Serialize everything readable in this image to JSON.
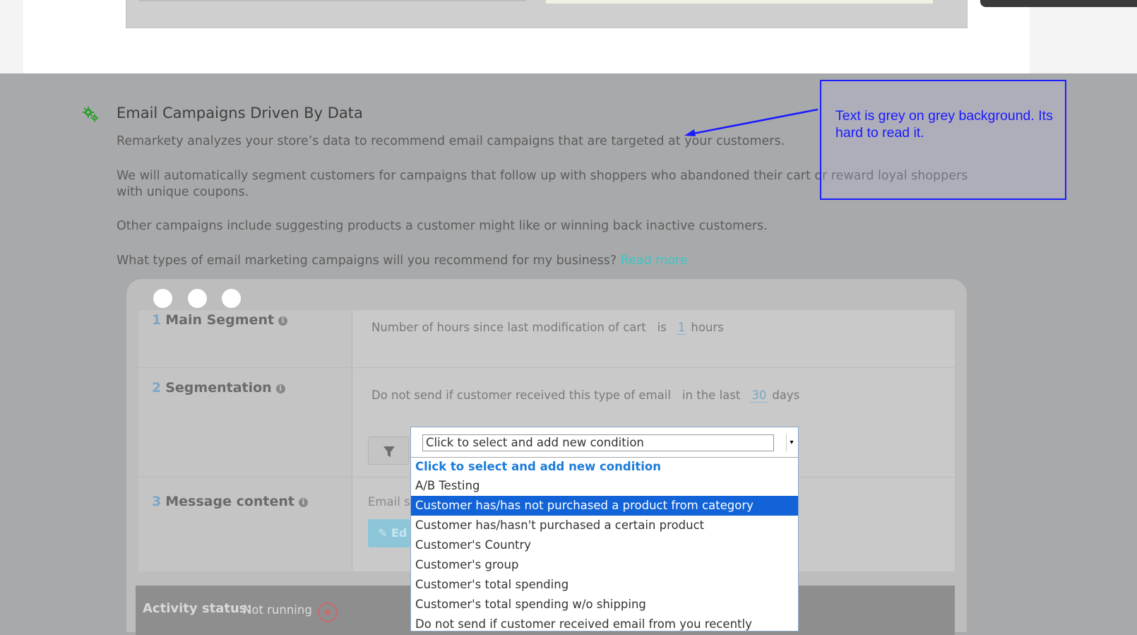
{
  "feature": {
    "title": "Email Campaigns Driven By Data",
    "p1": "Remarkety analyzes your store’s data to recommend email campaigns that are targeted at your customers.",
    "p2": "We will automatically segment customers for campaigns that follow up with shoppers who abandoned their cart or reward loyal shoppers with unique coupons.",
    "p3": "Other campaigns include suggesting products a customer might like or winning back inactive customers.",
    "p4_question": "What types of email marketing campaigns will you recommend for my business?",
    "read_more": "Read more",
    "icon": "gears-icon",
    "icon_color": "#2e9e2e"
  },
  "annotation": {
    "text": "Text is grey on grey background. Its hard to read it.",
    "color": "#1a1aff"
  },
  "mockup": {
    "steps": [
      {
        "num": "1",
        "label": "Main Segment"
      },
      {
        "num": "2",
        "label": "Segmentation"
      },
      {
        "num": "3",
        "label": "Message content"
      }
    ],
    "main_segment": {
      "text": "Number of hours since last modification of cart",
      "op": "is",
      "value": "1",
      "unit": "hours"
    },
    "segmentation": {
      "text": "Do not send if customer received this type of email",
      "op": "in the last",
      "value": "30",
      "unit": "days"
    },
    "email_label": "Email st",
    "edit_label": "Ed",
    "activity_label": "Activity status:",
    "activity_value": "Not running"
  },
  "dropdown": {
    "selected_value": "Click to select and add new condition",
    "options": [
      "Click to select and add new condition",
      "A/B Testing",
      "Customer has/has not purchased a product from category",
      "Customer has/hasn't purchased a certain product",
      "Customer's Country",
      "Customer's group",
      "Customer's total spending",
      "Customer's total spending w/o shipping",
      "Do not send if customer received email from you recently"
    ],
    "highlighted_index": 2
  }
}
